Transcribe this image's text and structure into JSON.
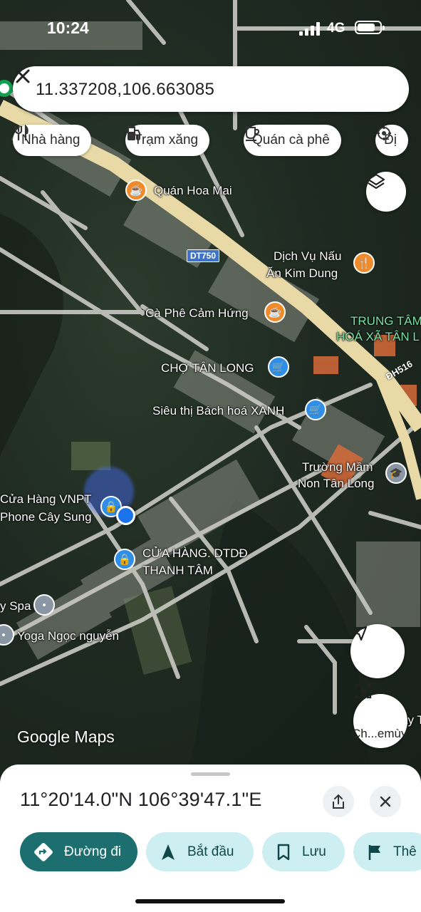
{
  "status_bar": {
    "time": "10:24",
    "network": "4G"
  },
  "search": {
    "query": "11.337208,106.663085"
  },
  "chips": [
    {
      "label": "Nhà hàng",
      "icon": "fork-knife-icon"
    },
    {
      "label": "Trạm xăng",
      "icon": "gas-pump-icon"
    },
    {
      "label": "Quán cà phê",
      "icon": "coffee-cup-icon"
    },
    {
      "label": "Đị",
      "icon": "attraction-icon"
    }
  ],
  "map": {
    "road_labels": {
      "dt750": "DT750",
      "dh516": "ĐH516"
    },
    "pois": [
      {
        "label": "Quán Hoa Mai",
        "type": "cafe"
      },
      {
        "label": "Dịch Vụ Nấu",
        "type": "restaurant"
      },
      {
        "label": "Ăn Kim Dung",
        "type": "restaurant"
      },
      {
        "label": "Cà Phê Cảm Hứng",
        "type": "cafe"
      },
      {
        "label": "TRUNG TÂM",
        "type": "area"
      },
      {
        "label": "HOÁ XÃ TÂN L",
        "type": "area"
      },
      {
        "label": "CHỢ TÂN LONG",
        "type": "market"
      },
      {
        "label": "Siêu thị Bách hoá XANH",
        "type": "supermarket"
      },
      {
        "label": "Trường Mầm",
        "type": "school"
      },
      {
        "label": "Non Tân Long",
        "type": "school"
      },
      {
        "label": "Cửa Hàng VNPT",
        "type": "shop"
      },
      {
        "label": "Phone Cây Sung",
        "type": "shop"
      },
      {
        "label": "CỬA HÀNG. DTDĐ",
        "type": "shop"
      },
      {
        "label": "THANH TÂM",
        "type": "shop"
      },
      {
        "label": "y Spa",
        "type": "spa"
      },
      {
        "label": "Yoga Ngọc nguyễn",
        "type": "gym"
      },
      {
        "label": "ầy T",
        "type": "other"
      }
    ],
    "logo": "Google Maps",
    "lens_caption": "Ch...emùy"
  },
  "sheet": {
    "coordinates": "11°20'14.0\"N 106°39'47.1\"E",
    "actions": [
      {
        "label": "Đường đi",
        "icon": "directions-icon"
      },
      {
        "label": "Bắt đầu",
        "icon": "navigation-arrow-icon"
      },
      {
        "label": "Lưu",
        "icon": "bookmark-icon"
      },
      {
        "label": "Thê",
        "icon": "flag-icon"
      }
    ]
  },
  "colors": {
    "accent": "#1c6e6f",
    "secondary": "#cdeff2",
    "main_road": "#e8d9a6",
    "poi_orange": "#f08b2b",
    "poi_blue": "#2f8fe8"
  }
}
